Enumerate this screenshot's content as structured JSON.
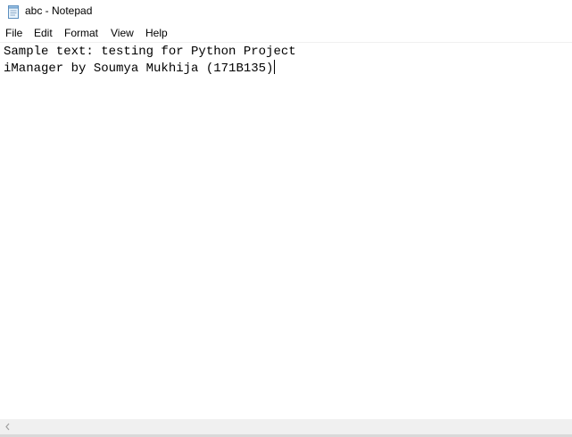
{
  "window": {
    "title": "abc - Notepad",
    "app_icon": "notepad-icon"
  },
  "menu": {
    "items": [
      {
        "label": "File"
      },
      {
        "label": "Edit"
      },
      {
        "label": "Format"
      },
      {
        "label": "View"
      },
      {
        "label": "Help"
      }
    ]
  },
  "editor": {
    "lines": [
      "Sample text: testing for Python Project",
      "iManager by Soumya Mukhija (171B135)"
    ]
  },
  "scrollbar": {
    "left_arrow_icon": "chevron-left-icon"
  }
}
